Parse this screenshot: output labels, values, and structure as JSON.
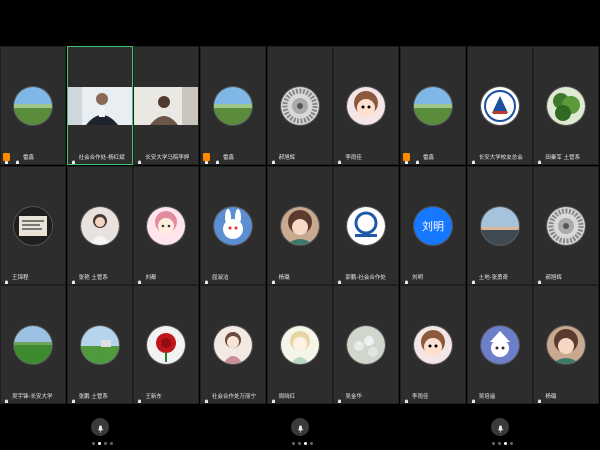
{
  "colors": {
    "active_border": "#3ec46d",
    "host_badge": "#ff8a00",
    "text_avatar": "#1677ff"
  },
  "rows": [
    [
      {
        "name": "雷鑫",
        "avatar": "landscape",
        "host": true
      },
      {
        "name": "社会合作处-杨红斌",
        "avatar": "video-man",
        "active": true
      },
      {
        "name": "长安大学马院李婷",
        "avatar": "video-woman"
      },
      {
        "name": "雷鑫",
        "avatar": "landscape",
        "host": true
      },
      {
        "name": "郝旭辉",
        "avatar": "gear"
      },
      {
        "name": "李雨佳",
        "avatar": "doll-brown"
      },
      {
        "name": "雷鑫",
        "avatar": "landscape",
        "host": true
      },
      {
        "name": "长安大学校友总会",
        "avatar": "school-logo"
      },
      {
        "name": "田秦军 土管系",
        "avatar": "tree"
      }
    ],
    [
      {
        "name": "王锦程",
        "avatar": "screen"
      },
      {
        "name": "张艳 土管系",
        "avatar": "girl"
      },
      {
        "name": "刘都",
        "avatar": "anime-girl"
      },
      {
        "name": "屈淑洁",
        "avatar": "bunny"
      },
      {
        "name": "杨璐",
        "avatar": "anime-dark"
      },
      {
        "name": "郭鹏-社会合作处",
        "avatar": "chd-logo"
      },
      {
        "name": "刘明",
        "avatar": "text",
        "avatar_text": "刘明"
      },
      {
        "name": "土地-张勇奇",
        "avatar": "sky"
      },
      {
        "name": "郝旭辉",
        "avatar": "gear"
      }
    ],
    [
      {
        "name": "吴宇锋-长安大学",
        "avatar": "field"
      },
      {
        "name": "张鹏 土管系",
        "avatar": "field2"
      },
      {
        "name": "王新东",
        "avatar": "rose"
      },
      {
        "name": "社会合作处万丽宁",
        "avatar": "sketch-girl"
      },
      {
        "name": "周晓红",
        "avatar": "fairy"
      },
      {
        "name": "吴金华",
        "avatar": "flowers"
      },
      {
        "name": "李雨佳",
        "avatar": "doll-brown"
      },
      {
        "name": "吴培遥",
        "avatar": "bunny-hat"
      },
      {
        "name": "杨璐",
        "avatar": "anime-dark"
      }
    ]
  ],
  "pages": [
    {
      "dots": 4,
      "active": 1
    },
    {
      "dots": 4,
      "active": 2
    },
    {
      "dots": 4,
      "active": 2
    }
  ]
}
